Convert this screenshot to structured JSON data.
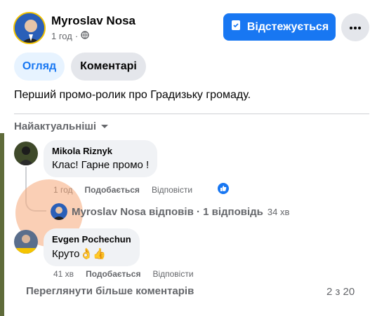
{
  "post": {
    "author": "Myroslav Nosa",
    "time": "1 год",
    "text": "Перший промо-ролик про Градизьку громаду."
  },
  "header": {
    "follow_label": "Відстежується",
    "more_label": "•••"
  },
  "tabs": [
    {
      "label": "Огляд",
      "active": true
    },
    {
      "label": "Коментарі",
      "active": false
    }
  ],
  "sort_label": "Найактуальніші",
  "comments": [
    {
      "author": "Mikola Riznyk",
      "text": "Клас! Гарне промо !",
      "time": "1 год",
      "like_label": "Подобається",
      "reply_label": "Відповісти"
    },
    {
      "author": "Evgen Pochechun",
      "text": "Круто👌👍",
      "time": "41 хв",
      "like_label": "Подобається",
      "reply_label": "Відповісти"
    }
  ],
  "reply_summary": {
    "text": "Myroslav Nosa відповів · 1 відповідь",
    "time": "34 хв"
  },
  "footer": {
    "more_comments": "Переглянути більше коментарів",
    "count": "2 з 20"
  },
  "colors": {
    "accent": "#1877f2",
    "muted": "#65676b",
    "bubble": "#f0f2f5"
  },
  "icons": [
    "globe-icon",
    "bookmark-check-icon",
    "chevron-down-icon",
    "like-icon",
    "more-icon"
  ]
}
